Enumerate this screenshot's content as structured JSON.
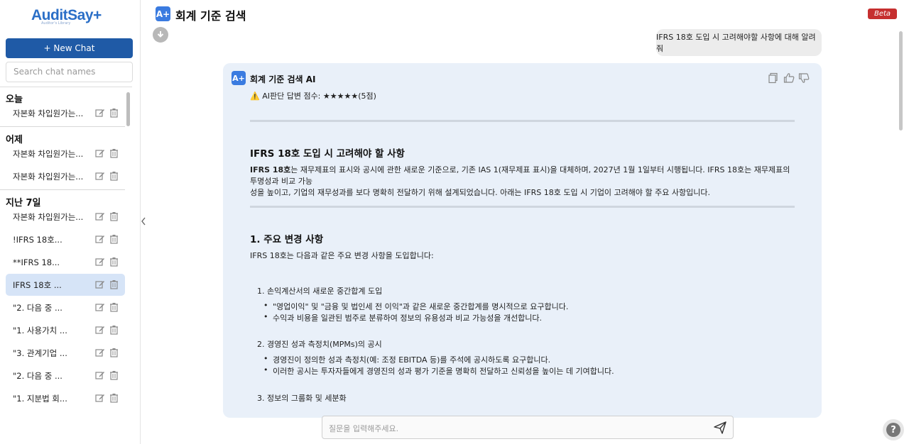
{
  "brand": {
    "name": "AuditSay",
    "plus": "+",
    "tagline": "Auditor's Library"
  },
  "sidebar": {
    "new_chat_label": "+ New Chat",
    "search_placeholder": "Search chat names",
    "groups": {
      "today": "오늘",
      "yesterday": "어제",
      "last7": "지난 7일"
    },
    "items": [
      {
        "name": "자본화 차입원가는..."
      },
      {
        "name": "자본화 차입원가는..."
      },
      {
        "name": "자본화 차입원가는..."
      },
      {
        "name": "자본화 차입원가는..."
      },
      {
        "name": "!IFRS 18호..."
      },
      {
        "name": "**IFRS 18..."
      },
      {
        "name": "IFRS 18호 ..."
      },
      {
        "name": "\"2. 다음 중 ..."
      },
      {
        "name": "\"1. 사용가치 ..."
      },
      {
        "name": "\"3. 관계기업 ..."
      },
      {
        "name": "\"2. 다음 중 ..."
      },
      {
        "name": "\"1. 지분법 회..."
      }
    ]
  },
  "header": {
    "title": "회계 기준 검색",
    "badge": "Beta",
    "app_icon": "A+"
  },
  "conversation": {
    "user_message": "IFRS 18호 도입 시 고려해야할 사항에 대해 알려줘",
    "ai_name": "회계 기준 검색 AI",
    "rating": "AI판단 답변 점수: ★★★★★(5점)",
    "heading1": "IFRS 18호 도입 시 고려해야 할 사항",
    "intro_bold": "IFRS 18호",
    "intro_line1": "는 재무제표의 표시와 공시에 관한 새로운 기준으로, 기존 IAS 1(재무제표 표시)을 대체하며, 2027년 1월 1일부터 시행됩니다. IFRS 18호는 재무제표의 투명성과 비교 가능",
    "intro_line2": "성을 높이고, 기업의 재무성과를 보다 명확히 전달하기 위해 설계되었습니다. 아래는 IFRS 18호 도입 시 기업이 고려해야 할 주요 사항입니다.",
    "heading2": "1. 주요 변경 사항",
    "section_intro": "IFRS 18호는 다음과 같은 주요 변경 사항을 도입합니다:",
    "ol": [
      {
        "title": "1. 손익계산서의 새로운 중간합계 도입",
        "bullets": [
          "\"영업이익\" 및 \"금융 및 법인세 전 이익\"과 같은 새로운 중간합계를 명시적으로 요구합니다.",
          "수익과 비용을 일관된 범주로 분류하여 정보의 유용성과 비교 가능성을 개선합니다."
        ]
      },
      {
        "title": "2. 경영진 성과 측정치(MPMs)의 공시",
        "bullets": [
          "경영진이 정의한 성과 측정치(예: 조정 EBITDA 등)를 주석에 공시하도록 요구합니다.",
          "이러한 공시는 투자자들에게 경영진의 성과 평가 기준을 명확히 전달하고 신뢰성을 높이는 데 기여합니다."
        ]
      },
      {
        "title": "3. 정보의 그룹화 및 세분화",
        "bullets": []
      }
    ]
  },
  "input": {
    "placeholder": "질문을 입력해주세요."
  },
  "icons": {
    "send": "send-icon",
    "help": "help-icon",
    "copy": "copy-icon",
    "thumbs_up": "thumbs-up-icon",
    "thumbs_down": "thumbs-down-icon"
  },
  "help_label": "?"
}
